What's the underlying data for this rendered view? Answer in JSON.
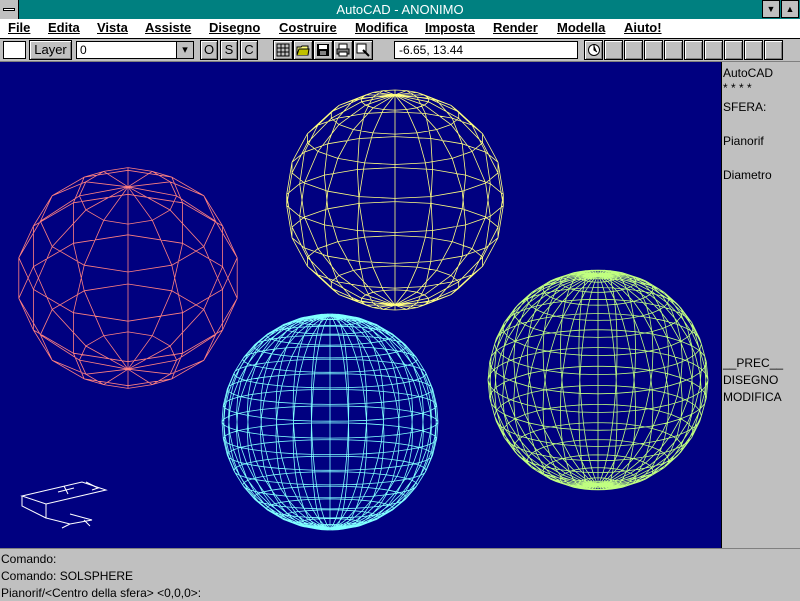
{
  "window": {
    "title": "AutoCAD - ANONIMO",
    "scroll_down_glyph": "▼",
    "scroll_up_glyph": "▲"
  },
  "menu": [
    "File",
    "Edita",
    "Vista",
    "Assiste",
    "Disegno",
    "Costruire",
    "Modifica",
    "Imposta",
    "Render",
    "Modella",
    "Aiuto!"
  ],
  "toolbar": {
    "layer_button": "Layer",
    "layer_value": "0",
    "layer_dropdown_glyph": "▾",
    "toggles": [
      "O",
      "S",
      "C"
    ],
    "coordinates": "-6.65, 13.44"
  },
  "side_menu": {
    "items": [
      "AutoCAD",
      "* * * *",
      "SFERA:",
      "Pianorif",
      "Diametro",
      "__PREC__",
      "DISEGNO",
      "MODIFICA"
    ]
  },
  "command_lines": [
    "Comando:",
    "Comando: SOLSPHERE",
    "Pianorif/<Centro della sfera> <0,0,0>:"
  ],
  "spheres": [
    {
      "name": "pink-sphere",
      "color": "#ff8080"
    },
    {
      "name": "yellow-sphere",
      "color": "#ffff80"
    },
    {
      "name": "cyan-sphere",
      "color": "#80ffff"
    },
    {
      "name": "green-sphere",
      "color": "#c0ff80"
    }
  ],
  "colors": {
    "titlebar": "#008080",
    "canvas": "#000080",
    "chrome": "#c0c0c0"
  }
}
